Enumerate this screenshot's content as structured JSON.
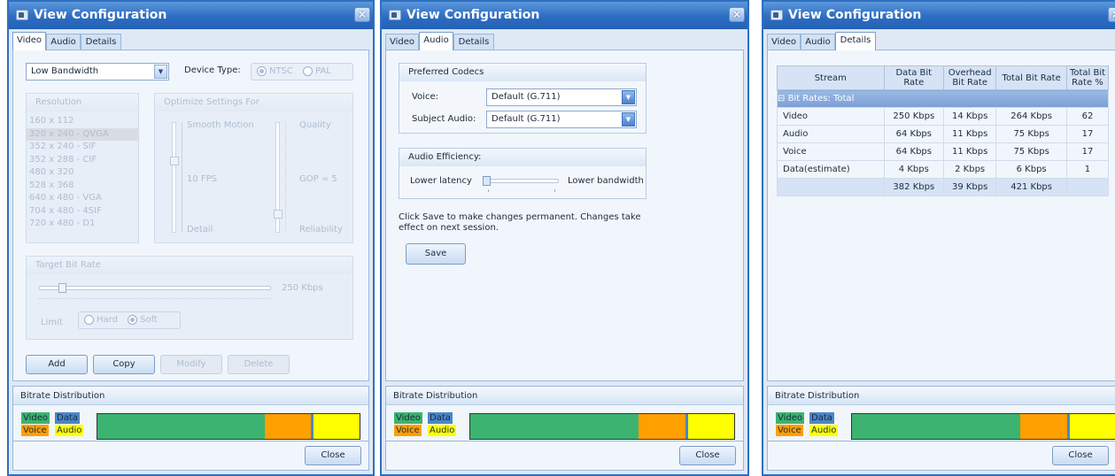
{
  "window": {
    "title": "View Configuration",
    "close_glyph": "×"
  },
  "tabs": [
    "Video",
    "Audio",
    "Details"
  ],
  "video": {
    "profile": "Low Bandwidth",
    "device_type_label": "Device Type:",
    "ntsc": "NTSC",
    "pal": "PAL",
    "resolution_header": "Resolution",
    "resolutions": [
      "160 x 112",
      "320 x 240 - QVGA",
      "352 x 240 - SIF",
      "352 x 288 - CIF",
      "480 x 320",
      "528 x 368",
      "640 x 480 - VGA",
      "704 x 480 - 4SIF",
      "720 x 480 - D1"
    ],
    "optimize_header": "Optimize Settings For",
    "smooth_motion": "Smooth Motion",
    "fps": "10 FPS",
    "detail": "Detail",
    "quality": "Quality",
    "gop": "GOP = 5",
    "reliability": "Reliability",
    "target_header": "Target Bit Rate",
    "target_value": "250 Kbps",
    "limit_label": "Limit",
    "hard": "Hard",
    "soft": "Soft",
    "buttons": {
      "add": "Add",
      "copy": "Copy",
      "modify": "Modify",
      "delete": "Delete"
    }
  },
  "audio": {
    "preferred_header": "Preferred Codecs",
    "voice_label": "Voice:",
    "voice_value": "Default (G.711)",
    "subject_label": "Subject Audio:",
    "subject_value": "Default (G.711)",
    "efficiency_header": "Audio Efficiency:",
    "lower_latency": "Lower latency",
    "lower_bandwidth": "Lower bandwidth",
    "note": "Click Save to make changes permanent. Changes take effect on next session.",
    "save": "Save"
  },
  "details": {
    "headers": [
      "Stream",
      "Data Bit Rate",
      "Overhead Bit Rate",
      "Total Bit Rate",
      "Total Bit Rate %"
    ],
    "group_label": "Bit Rates: Total",
    "rows": [
      [
        "Video",
        "250 Kbps",
        "14 Kbps",
        "264 Kbps",
        "62"
      ],
      [
        "Audio",
        "64 Kbps",
        "11 Kbps",
        "75 Kbps",
        "17"
      ],
      [
        "Voice",
        "64 Kbps",
        "11 Kbps",
        "75 Kbps",
        "17"
      ],
      [
        "Data(estimate)",
        "4 Kbps",
        "2 Kbps",
        "6 Kbps",
        "1"
      ]
    ],
    "totals": [
      "",
      "382 Kbps",
      "39 Kbps",
      "421 Kbps",
      ""
    ]
  },
  "bitrate": {
    "header": "Bitrate Distribution",
    "legend": {
      "video": "Video",
      "data": "Data",
      "voice": "Voice",
      "audio": "Audio"
    },
    "colors": {
      "video": "#3cb371",
      "data": "#4a86c8",
      "voice": "#ff9f00",
      "audio": "#ffff00"
    },
    "shares": {
      "video": 62,
      "voice": 17,
      "data": 1,
      "audio": 17
    }
  },
  "close": "Close"
}
